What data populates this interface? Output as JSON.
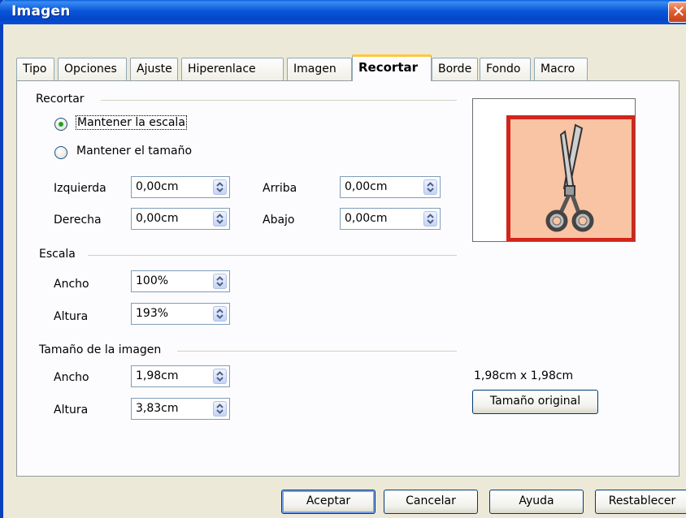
{
  "window": {
    "title": "Imagen",
    "close_glyph": "✕"
  },
  "tabs": [
    {
      "label": "Tipo"
    },
    {
      "label": "Opciones"
    },
    {
      "label": "Ajuste"
    },
    {
      "label": "Hiperenlace"
    },
    {
      "label": "Imagen"
    },
    {
      "label": "Recortar",
      "active": true
    },
    {
      "label": "Borde"
    },
    {
      "label": "Fondo"
    },
    {
      "label": "Macro"
    }
  ],
  "crop": {
    "group_label": "Recortar",
    "keep_scale_label": "Mantener la escala",
    "keep_size_label": "Mantener el tamaño",
    "selected": "keep_scale",
    "left_label": "Izquierda",
    "left_value": "0,00cm",
    "right_label": "Derecha",
    "right_value": "0,00cm",
    "top_label": "Arriba",
    "top_value": "0,00cm",
    "bottom_label": "Abajo",
    "bottom_value": "0,00cm"
  },
  "scale": {
    "group_label": "Escala",
    "width_label": "Ancho",
    "width_value": "100%",
    "height_label": "Altura",
    "height_value": "193%"
  },
  "image_size": {
    "group_label": "Tamaño de la imagen",
    "width_label": "Ancho",
    "width_value": "1,98cm",
    "height_label": "Altura",
    "height_value": "3,83cm",
    "original_size_text": "1,98cm x 1,98cm",
    "original_size_button": "Tamaño original"
  },
  "preview": {
    "icon": "scissors-icon",
    "frame_color": "#d2251c",
    "fill_color": "#f9c4a3"
  },
  "footer": {
    "ok": "Aceptar",
    "cancel": "Cancelar",
    "help": "Ayuda",
    "reset": "Restablecer"
  },
  "colors": {
    "titlebar": "#0a56d8",
    "dialog_bg": "#ece9d8",
    "active_tab_accent": "#ffc83c"
  }
}
